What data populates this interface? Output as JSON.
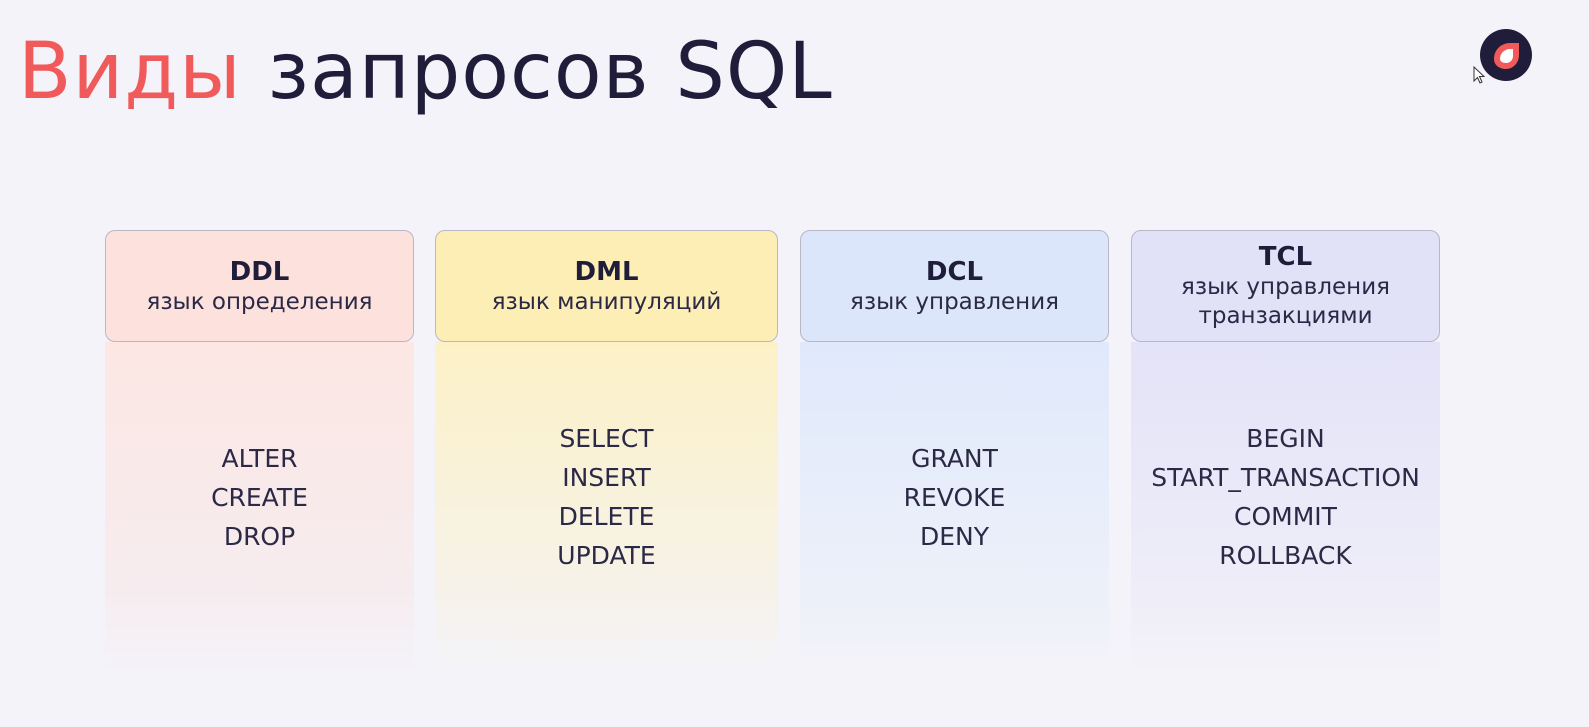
{
  "title": {
    "accent": "Виды",
    "rest": "запросов SQL"
  },
  "logo": {
    "icon": "brand-ring-logo",
    "colors": {
      "ring": "#1f1d3a",
      "inner": "#f05a5a",
      "center": "#ffffff"
    }
  },
  "colors": {
    "accent": "#f05a5a",
    "text": "#1f1d3a",
    "background": "#f4f3f9"
  },
  "columns": [
    {
      "id": "ddl",
      "code": "DDL",
      "description": "язык определения",
      "color": "#fde1dd",
      "commands": [
        "ALTER",
        "CREATE",
        "DROP"
      ]
    },
    {
      "id": "dml",
      "code": "DML",
      "description": "язык манипуляций",
      "color": "#fdeeb5",
      "commands": [
        "SELECT",
        "INSERT",
        "DELETE",
        "UPDATE"
      ]
    },
    {
      "id": "dcl",
      "code": "DCL",
      "description": "язык управления",
      "color": "#dbe6fb",
      "commands": [
        "GRANT",
        "REVOKE",
        "DENY"
      ]
    },
    {
      "id": "tcl",
      "code": "TCL",
      "description_lines": [
        "язык управления",
        "транзакциями"
      ],
      "color": "#e1e1f8",
      "commands": [
        "BEGIN",
        "START_TRANSACTION",
        "COMMIT",
        "ROLLBACK"
      ]
    }
  ]
}
